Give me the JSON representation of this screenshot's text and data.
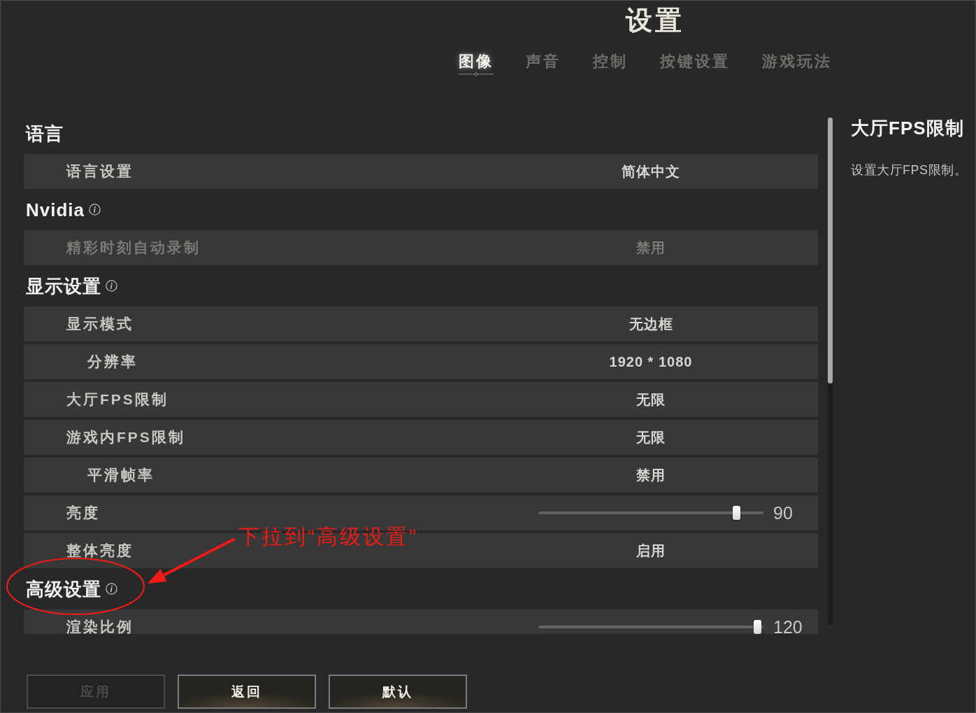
{
  "window": {
    "title": "设置"
  },
  "tabs": [
    {
      "label": "图像",
      "selected": true
    },
    {
      "label": "声音",
      "selected": false
    },
    {
      "label": "控制",
      "selected": false
    },
    {
      "label": "按键设置",
      "selected": false
    },
    {
      "label": "游戏玩法",
      "selected": false
    }
  ],
  "sections": [
    {
      "title": "语言",
      "info": false,
      "rows": [
        {
          "kind": "select",
          "label": "语言设置",
          "value": "简体中文",
          "disabled": false
        }
      ]
    },
    {
      "title": "Nvidia",
      "info": true,
      "rows": [
        {
          "kind": "select",
          "label": "精彩时刻自动录制",
          "value": "禁用",
          "disabled": true
        }
      ]
    },
    {
      "title": "显示设置",
      "info": true,
      "rows": [
        {
          "kind": "select",
          "label": "显示模式",
          "value": "无边框",
          "disabled": false,
          "children": [
            {
              "kind": "select",
              "label": "分辨率",
              "value": "1920 * 1080",
              "disabled": false
            }
          ]
        },
        {
          "kind": "select",
          "label": "大厅FPS限制",
          "value": "无限",
          "disabled": false
        },
        {
          "kind": "select",
          "label": "游戏内FPS限制",
          "value": "无限",
          "disabled": false,
          "children": [
            {
              "kind": "select",
              "label": "平滑帧率",
              "value": "禁用",
              "disabled": false
            }
          ]
        },
        {
          "kind": "slider",
          "label": "亮度",
          "level": 0.9,
          "reading": "90",
          "disabled": false
        },
        {
          "kind": "select",
          "label": "整体亮度",
          "value": "启用",
          "disabled": false
        }
      ]
    },
    {
      "title": "高级设置",
      "info": true,
      "rows": [
        {
          "kind": "slider",
          "label": "渲染比例",
          "level": 1,
          "reading": "120",
          "disabled": false
        }
      ]
    }
  ],
  "detail": {
    "title": "大厅FPS限制",
    "description": "设置大厅FPS限制。"
  },
  "annotation": {
    "text": "下拉到“高级设置”"
  },
  "buttons": [
    {
      "label": "应用",
      "disabled": true
    },
    {
      "label": "返回",
      "disabled": false
    },
    {
      "label": "默认",
      "disabled": false
    }
  ]
}
